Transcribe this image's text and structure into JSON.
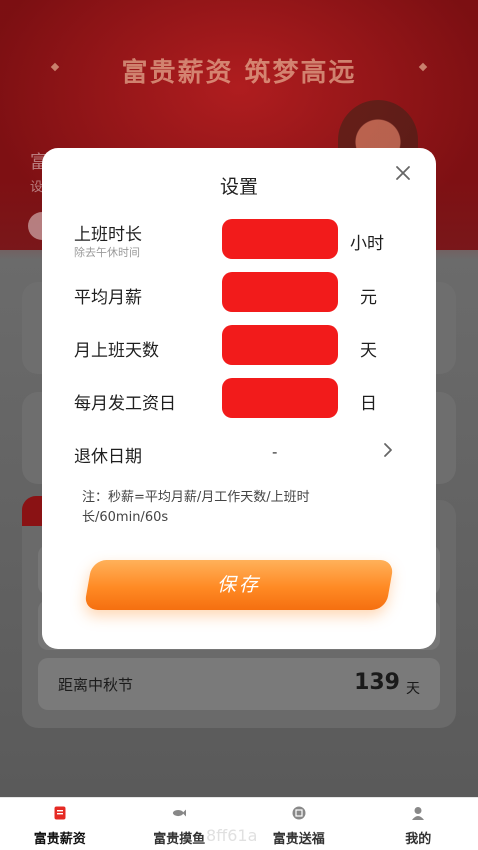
{
  "background": {
    "banner_title": "富贵薪资 筑梦高远",
    "partial_text_1": "富",
    "partial_text_2": "设",
    "mid_autumn_label": "距离中秋节",
    "mid_autumn_days": "139",
    "mid_autumn_unit": "天"
  },
  "dialog": {
    "title": "设置",
    "fields": [
      {
        "label": "上班时长",
        "sub": "除去午休时间",
        "unit": "小时",
        "value": ""
      },
      {
        "label": "平均月薪",
        "unit": "元",
        "value": ""
      },
      {
        "label": "月上班天数",
        "unit": "天",
        "value": ""
      },
      {
        "label": "每月发工资日",
        "unit": "日",
        "value": ""
      }
    ],
    "retire_label": "退休日期",
    "retire_value": "-",
    "note": "注：秒薪=平均月薪/月工作天数/上班时长/60min/60s",
    "save_label": "保存"
  },
  "bottom_nav": [
    {
      "label": "富贵薪资",
      "icon": "document-icon",
      "active": true
    },
    {
      "label": "富贵摸鱼",
      "icon": "fish-icon",
      "active": false
    },
    {
      "label": "富贵送福",
      "icon": "fortune-icon",
      "active": false
    },
    {
      "label": "我的",
      "icon": "user-icon",
      "active": false
    }
  ],
  "watermark": "8ff61a",
  "colors": {
    "accent": "#f21b1b",
    "save_button": "#ff8a24",
    "banner": "#a51a1c"
  }
}
